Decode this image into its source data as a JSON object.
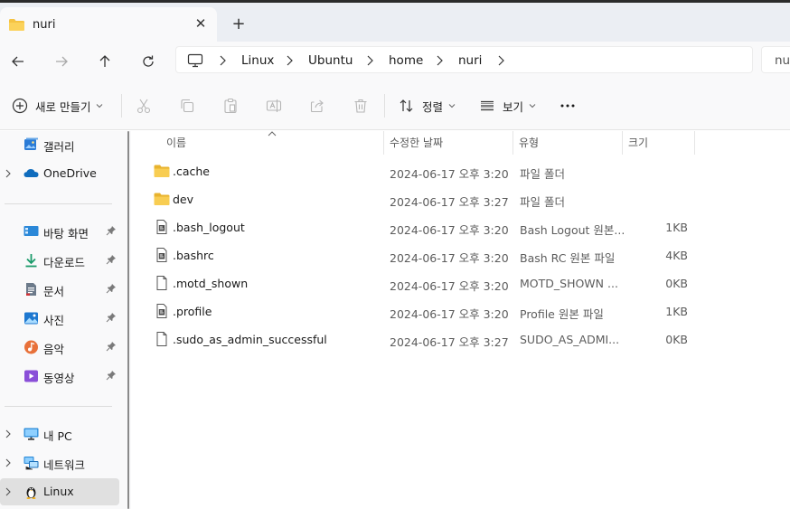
{
  "tab": {
    "title": "nuri",
    "close": "✕",
    "new": "+"
  },
  "address": {
    "crumbs": [
      "Linux",
      "Ubuntu",
      "home",
      "nuri"
    ],
    "search_partial": "nu"
  },
  "toolbar": {
    "new_label": "새로 만들기",
    "sort_label": "정렬",
    "view_label": "보기",
    "more": "•••"
  },
  "sidebar": {
    "gallery": "갤러리",
    "onedrive": "OneDrive",
    "quick": [
      {
        "label": "바탕 화면",
        "icon": "desktop-icon"
      },
      {
        "label": "다운로드",
        "icon": "download-icon"
      },
      {
        "label": "문서",
        "icon": "documents-icon"
      },
      {
        "label": "사진",
        "icon": "pictures-icon"
      },
      {
        "label": "음악",
        "icon": "music-icon"
      },
      {
        "label": "동영상",
        "icon": "videos-icon"
      }
    ],
    "this_pc": "내 PC",
    "network": "네트워크",
    "linux": "Linux"
  },
  "columns": {
    "name": "이름",
    "modified": "수정한 날짜",
    "type": "유형",
    "size": "크기"
  },
  "files": [
    {
      "name": ".cache",
      "date": "2024-06-17 오후 3:20",
      "type": "파일 폴더",
      "size": "",
      "kind": "folder"
    },
    {
      "name": "dev",
      "date": "2024-06-17 오후 3:27",
      "type": "파일 폴더",
      "size": "",
      "kind": "folder"
    },
    {
      "name": ".bash_logout",
      "date": "2024-06-17 오후 3:20",
      "type": "Bash Logout 원본...",
      "size": "1KB",
      "kind": "script"
    },
    {
      "name": ".bashrc",
      "date": "2024-06-17 오후 3:20",
      "type": "Bash RC 원본 파일",
      "size": "4KB",
      "kind": "script"
    },
    {
      "name": ".motd_shown",
      "date": "2024-06-17 오후 3:20",
      "type": "MOTD_SHOWN ...",
      "size": "0KB",
      "kind": "file"
    },
    {
      "name": ".profile",
      "date": "2024-06-17 오후 3:20",
      "type": "Profile 원본 파일",
      "size": "1KB",
      "kind": "script"
    },
    {
      "name": ".sudo_as_admin_successful",
      "date": "2024-06-17 오후 3:27",
      "type": "SUDO_AS_ADMI...",
      "size": "0KB",
      "kind": "file"
    }
  ],
  "colors": {
    "folder": "#f5c342",
    "accent": "#0067c0",
    "tabbar": "#ebeef3",
    "chrome": "#f9f9fa"
  }
}
